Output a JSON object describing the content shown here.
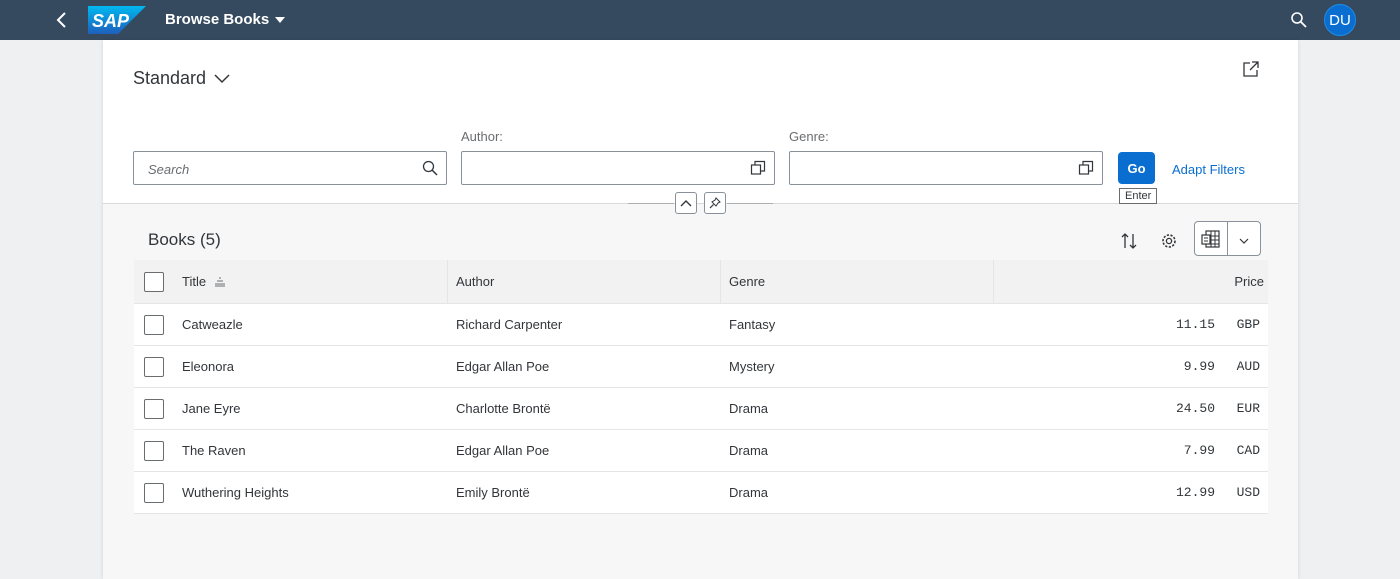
{
  "shell": {
    "logo_text": "SAP",
    "app_title": "Browse Books",
    "avatar_initials": "DU"
  },
  "header": {
    "variant": "Standard",
    "search_placeholder": "Search",
    "author_label": "Author:",
    "author_value": "",
    "genre_label": "Genre:",
    "genre_value": "",
    "go_label": "Go",
    "go_tooltip": "Enter",
    "adapt_filters_label": "Adapt Filters"
  },
  "table": {
    "title": "Books (5)",
    "columns": [
      "Title",
      "Author",
      "Genre",
      "Price"
    ],
    "rows": [
      {
        "title": "Catweazle",
        "author": "Richard Carpenter",
        "genre": "Fantasy",
        "price": "11.15",
        "currency": "GBP"
      },
      {
        "title": "Eleonora",
        "author": "Edgar Allan Poe",
        "genre": "Mystery",
        "price": "9.99",
        "currency": "AUD"
      },
      {
        "title": "Jane Eyre",
        "author": "Charlotte Brontë",
        "genre": "Drama",
        "price": "24.50",
        "currency": "EUR"
      },
      {
        "title": "The Raven",
        "author": "Edgar Allan Poe",
        "genre": "Drama",
        "price": "7.99",
        "currency": "CAD"
      },
      {
        "title": "Wuthering Heights",
        "author": "Emily Brontë",
        "genre": "Drama",
        "price": "12.99",
        "currency": "USD"
      }
    ]
  },
  "colors": {
    "shell_bg": "#354a5f",
    "brand_blue": "#0a6ed1",
    "text": "#32363a"
  }
}
